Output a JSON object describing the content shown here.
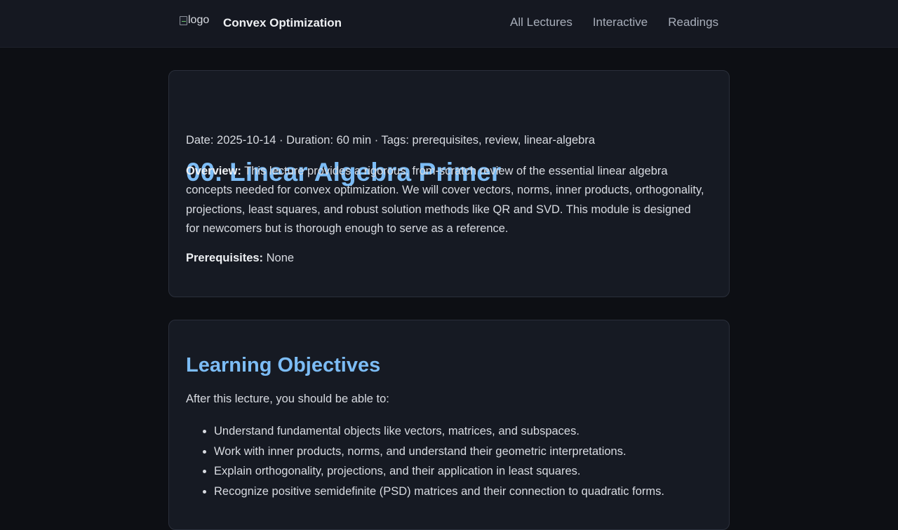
{
  "header": {
    "logo_alt": "logo",
    "site_title": "Convex Optimization",
    "nav": [
      {
        "label": "All Lectures"
      },
      {
        "label": "Interactive"
      },
      {
        "label": "Readings"
      }
    ]
  },
  "lecture": {
    "title": "00. Linear Algebra Primer",
    "meta": "Date: 2025-10-14 · Duration: 60 min · Tags: prerequisites, review, linear-algebra",
    "overview_label": "Overview:",
    "overview_text": "This lecture provides a rigorous, from-scratch review of the essential linear algebra concepts needed for convex optimization. We will cover vectors, norms, inner products, orthogonality, projections, least squares, and robust solution methods like QR and SVD. This module is designed for newcomers but is thorough enough to serve as a reference.",
    "prereq_label": "Prerequisites:",
    "prereq_value": "None"
  },
  "objectives": {
    "heading": "Learning Objectives",
    "intro": "After this lecture, you should be able to:",
    "items": [
      "Understand fundamental objects like vectors, matrices, and subspaces.",
      "Work with inner products, norms, and understand their geometric interpretations.",
      "Explain orthogonality, projections, and their application in least squares.",
      "Recognize positive semidefinite (PSD) matrices and their connection to quadratic forms."
    ]
  },
  "colors": {
    "accent": "#7cbcf5",
    "background": "#0d0f14",
    "card": "#161a23",
    "header": "#151821"
  }
}
